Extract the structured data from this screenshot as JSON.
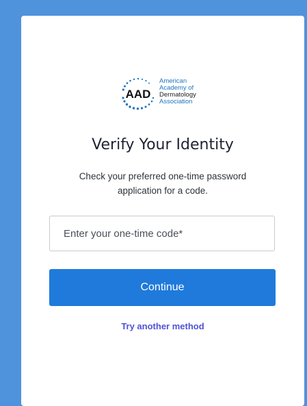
{
  "logo": {
    "abbr": "AAD",
    "line1": "American",
    "line2": "Academy of",
    "line3": "Dermatology",
    "line4": "Association"
  },
  "title": "Verify Your Identity",
  "description": "Check your preferred one-time password application for a code.",
  "otp": {
    "placeholder": "Enter your one-time code*",
    "value": ""
  },
  "continue_label": "Continue",
  "alt_method_label": "Try another method",
  "colors": {
    "background": "#4f93dc",
    "primary": "#1f7adb",
    "link": "#5250d6"
  }
}
